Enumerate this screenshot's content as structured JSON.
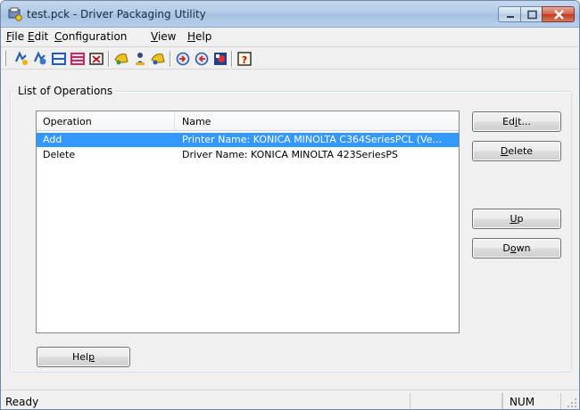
{
  "window": {
    "title": "test.pck - Driver Packaging Utility"
  },
  "menu": {
    "items": [
      {
        "label": "File",
        "mnemonic": "F",
        "rest": "ile"
      },
      {
        "label": "Edit",
        "mnemonic": "E",
        "rest": "dit"
      },
      {
        "label": "Configuration",
        "mnemonic": "C",
        "rest": "onfiguration"
      },
      {
        "label": "View",
        "mnemonic": "V",
        "rest": "iew"
      },
      {
        "label": "Help",
        "mnemonic": "H",
        "rest": "elp"
      }
    ]
  },
  "toolbar": {
    "icons": [
      "new-package-icon",
      "open-package-icon",
      "save-package-icon",
      "save-as-icon",
      "close-package-icon",
      "add-driver-icon",
      "user-icon",
      "add-printer-icon",
      "import-icon",
      "export-icon",
      "build-icon",
      "help-icon"
    ]
  },
  "group": {
    "label": "List of Operations"
  },
  "list": {
    "columns": [
      "Operation",
      "Name"
    ],
    "rows": [
      {
        "operation": "Add",
        "name": "Printer Name: KONICA MINOLTA C364SeriesPCL (Ve...",
        "selected": true
      },
      {
        "operation": "Delete",
        "name": "Driver Name: KONICA MINOLTA 423SeriesPS",
        "selected": false
      }
    ]
  },
  "buttons": {
    "edit": {
      "pre": "Ed",
      "mn": "i",
      "post": "t..."
    },
    "delete": {
      "pre": "",
      "mn": "D",
      "post": "elete"
    },
    "up": {
      "pre": "",
      "mn": "U",
      "post": "p"
    },
    "down": {
      "pre": "D",
      "mn": "o",
      "post": "wn"
    },
    "help": {
      "pre": "Hel",
      "mn": "p",
      "post": ""
    }
  },
  "status": {
    "text": "Ready",
    "num": "NUM"
  },
  "colors": {
    "selection": "#3399ff",
    "close_button": "#c23b20",
    "titlebar": "#b2cbe6"
  }
}
